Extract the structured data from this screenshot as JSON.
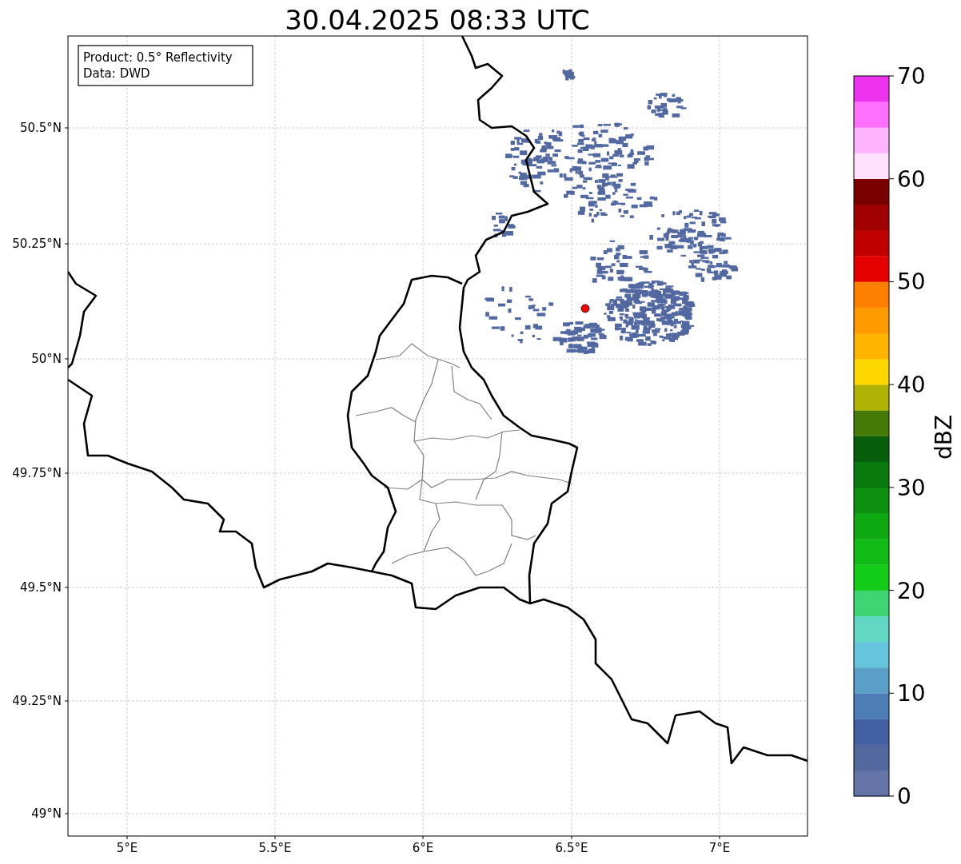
{
  "title": "30.04.2025 08:33 UTC",
  "info_box": {
    "lines": [
      "Product: 0.5° Reflectivity",
      "Data: DWD"
    ]
  },
  "map": {
    "x_ticks": [
      "5°E",
      "5.5°E",
      "6°E",
      "6.5°E",
      "7°E"
    ],
    "y_ticks": [
      "50.5°N",
      "50.25°N",
      "50°N",
      "49.75°N",
      "49.5°N",
      "49.25°N",
      "49°N"
    ]
  },
  "colorbar": {
    "label": "dBZ",
    "ticks": [
      "70",
      "60",
      "50",
      "40",
      "30",
      "20",
      "10",
      "0"
    ],
    "segments": [
      {
        "color": "#6474a8"
      },
      {
        "color": "#5468a0"
      },
      {
        "color": "#4460a4"
      },
      {
        "color": "#4c7db4"
      },
      {
        "color": "#5aa0c8"
      },
      {
        "color": "#66c4dc"
      },
      {
        "color": "#62d8c4"
      },
      {
        "color": "#3ed672"
      },
      {
        "color": "#12cc18"
      },
      {
        "color": "#10bb16"
      },
      {
        "color": "#0ea812"
      },
      {
        "color": "#0d8f10"
      },
      {
        "color": "#0b7a0e"
      },
      {
        "color": "#075e0a"
      },
      {
        "color": "#467a08"
      },
      {
        "color": "#b0b204"
      },
      {
        "color": "#ffd700"
      },
      {
        "color": "#ffb400"
      },
      {
        "color": "#ff9a00"
      },
      {
        "color": "#ff8000"
      },
      {
        "color": "#e60000"
      },
      {
        "color": "#c00000"
      },
      {
        "color": "#a00000"
      },
      {
        "color": "#7a0000"
      },
      {
        "color": "#ffe0ff"
      },
      {
        "color": "#ffb4ff"
      },
      {
        "color": "#ff70ff"
      },
      {
        "color": "#ee33ee"
      }
    ]
  }
}
